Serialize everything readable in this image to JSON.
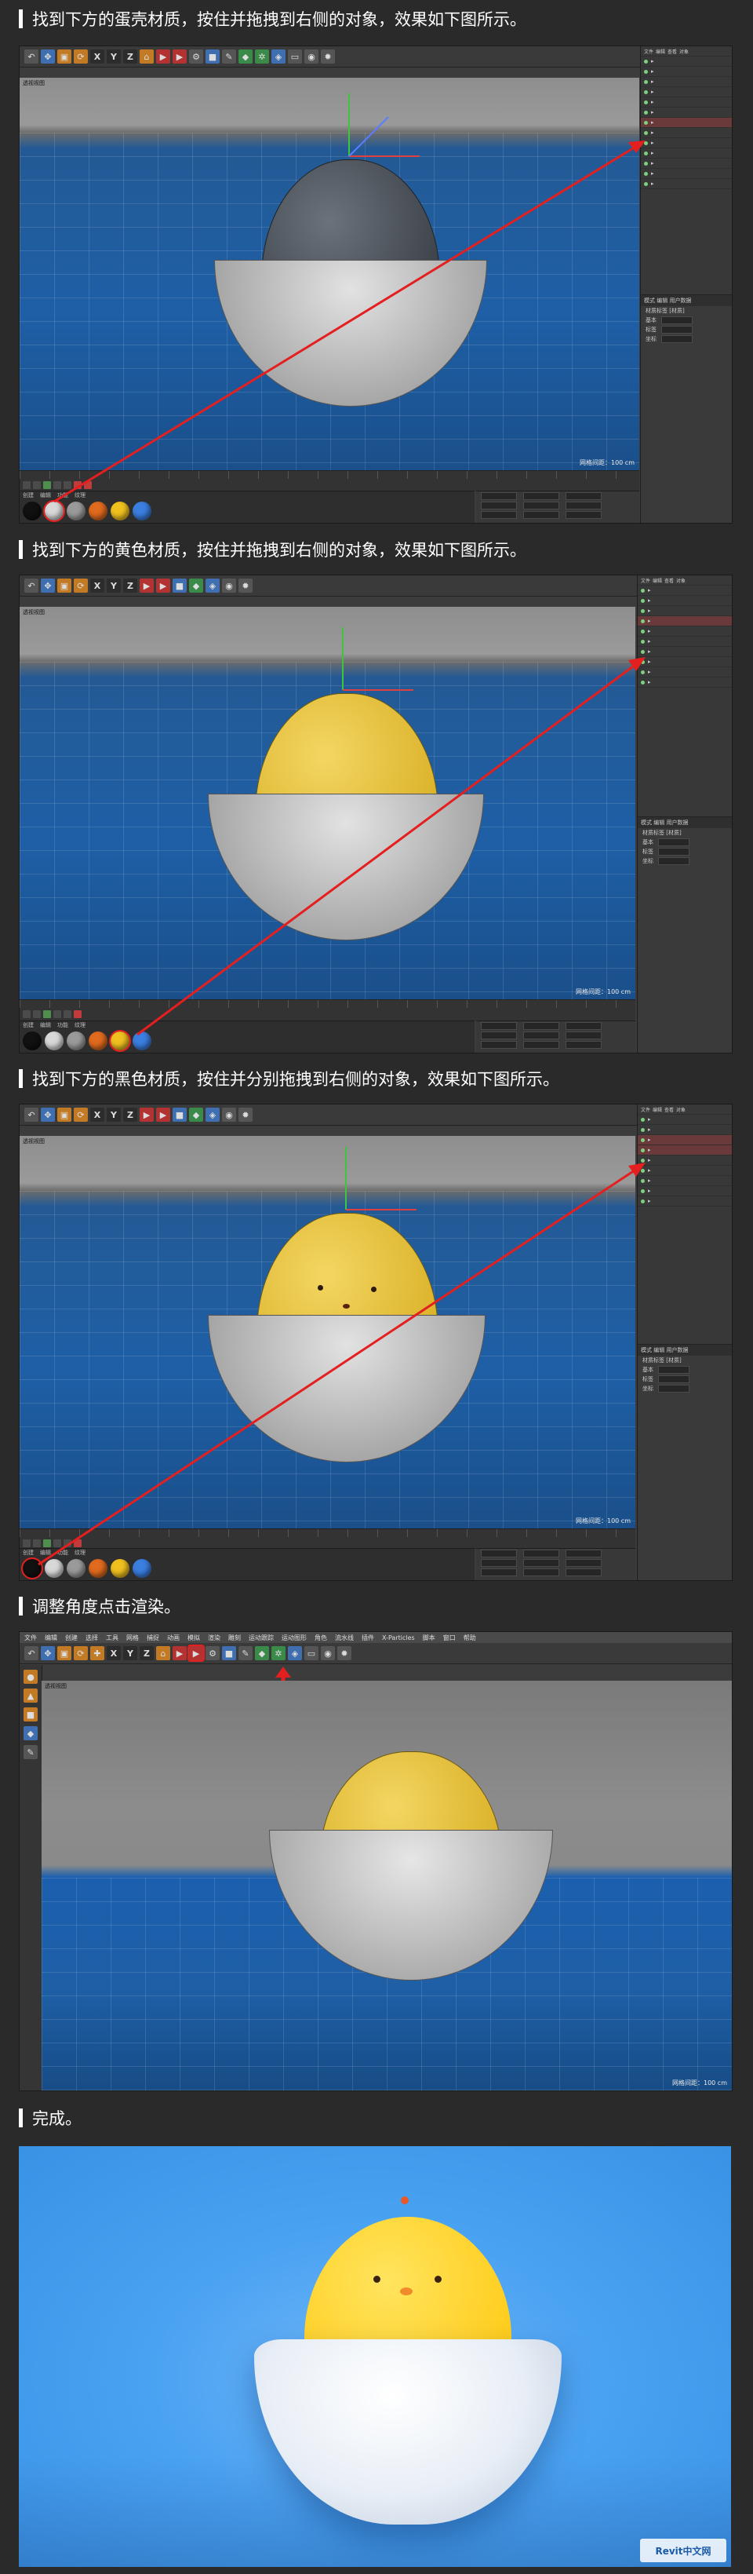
{
  "steps": [
    {
      "text": "找到下方的蛋壳材质，按住并拖拽到右侧的对象，效果如下图所示。"
    },
    {
      "text": "找到下方的黄色材质，按住并拖拽到右侧的对象，效果如下图所示。"
    },
    {
      "text": "找到下方的黑色材质，按住并分别拖拽到右侧的对象，效果如下图所示。"
    },
    {
      "text": "调整角度点击渲染。"
    },
    {
      "text": "完成。"
    }
  ],
  "toolbar": {
    "axis_x": "X",
    "axis_y": "Y",
    "axis_z": "Z"
  },
  "menu": {
    "items": [
      "文件",
      "编辑",
      "创建",
      "选择",
      "工具",
      "网格",
      "捕捉",
      "动画",
      "模拟",
      "渲染",
      "雕刻",
      "运动跟踪",
      "运动图形",
      "角色",
      "流水线",
      "插件",
      "X-Particles",
      "脚本",
      "窗口",
      "帮助"
    ]
  },
  "viewport": {
    "label": "透视视图",
    "status": "网格间距：100 cm"
  },
  "material_bar": {
    "menu": [
      "创建",
      "编辑",
      "功能",
      "纹理"
    ]
  },
  "right_panel": {
    "tabs": [
      "文件",
      "编辑",
      "查看",
      "对象",
      "标签",
      "书签"
    ],
    "attr_title": "模式  编辑  用户数据",
    "attr_sub": "材质标签 [材质]",
    "attr_rows": [
      "基本",
      "标签",
      "坐标"
    ]
  },
  "colors": {
    "egg_dark": "#4a4f56",
    "egg_yellow": "#e8c23a",
    "shell_grey": "#c4c4c4",
    "arrow_red": "#e41f1f",
    "bg_blue": "#4aa2f2",
    "chick_yellow": "#ffd629"
  },
  "materials": [
    {
      "name": "black",
      "color": "#111111"
    },
    {
      "name": "white",
      "color": "#d8d8d8"
    },
    {
      "name": "grey",
      "color": "#9a9a9a"
    },
    {
      "name": "orange",
      "color": "#e06a1e"
    },
    {
      "name": "yellow",
      "color": "#f0c020"
    },
    {
      "name": "blue",
      "color": "#3a7ee0"
    }
  ],
  "watermark": "Revit中文网"
}
